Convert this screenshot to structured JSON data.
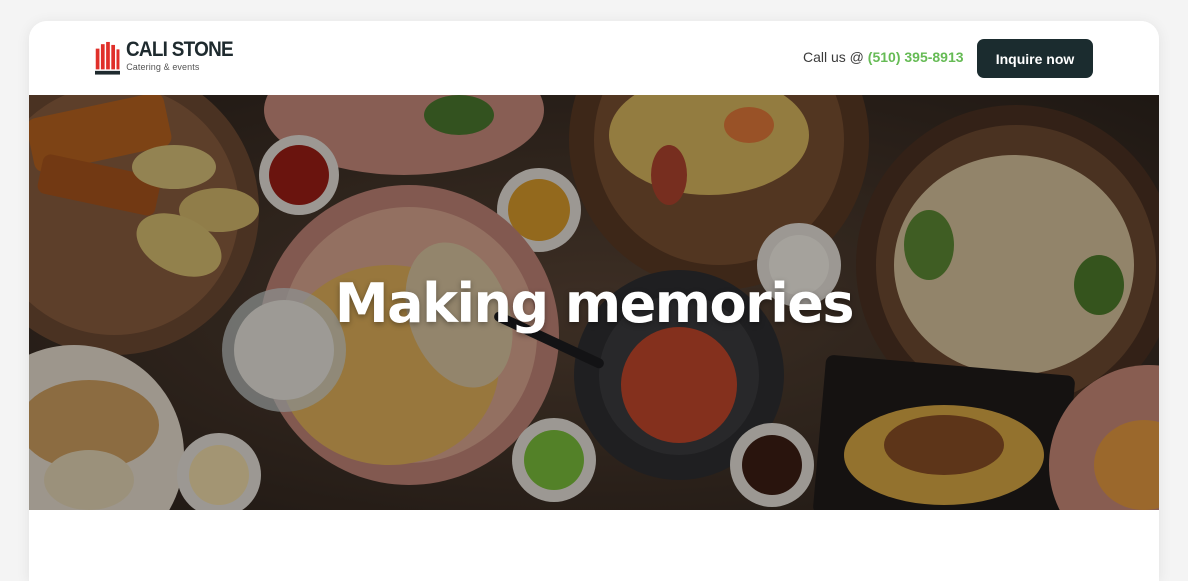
{
  "brand": {
    "name": "CALI STONE",
    "tagline": "Catering & events",
    "colors": {
      "mark_red": "#e0302a",
      "mark_dark": "#1e2a2e"
    }
  },
  "header": {
    "call_prefix": "Call us @ ",
    "phone": "(510) 395-8913",
    "cta_label": "Inquire now",
    "colors": {
      "phone": "#66bb55",
      "cta_bg": "#1b2c2f"
    }
  },
  "hero": {
    "title": "Making memories",
    "image_semantic": "food-spread-photo"
  }
}
